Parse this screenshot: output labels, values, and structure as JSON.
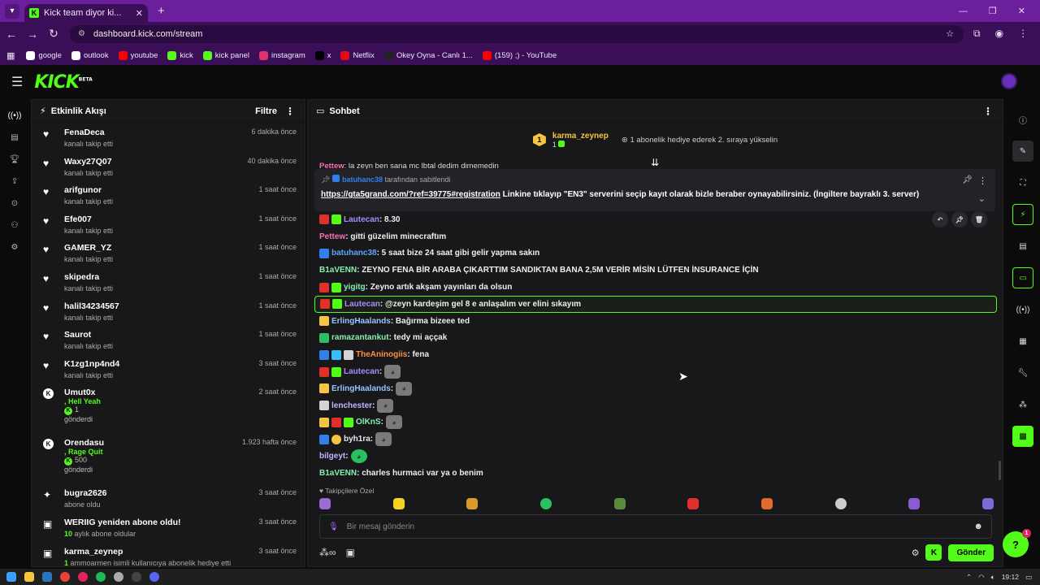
{
  "browser": {
    "tab_title": "Kick team diyor ki...",
    "tab_favicon": "K",
    "url": "dashboard.kick.com/stream",
    "bookmarks": [
      {
        "label": "google",
        "icon": "google-icon",
        "color": "#ffffff"
      },
      {
        "label": "outlook",
        "icon": "outlook-icon",
        "color": "#ffffff"
      },
      {
        "label": "youtube",
        "icon": "youtube-icon",
        "color": "#ff0000"
      },
      {
        "label": "kick",
        "icon": "kick-icon",
        "color": "#53fc18"
      },
      {
        "label": "kick panel",
        "icon": "kick-icon",
        "color": "#53fc18"
      },
      {
        "label": "instagram",
        "icon": "instagram-icon",
        "color": "#e1306c"
      },
      {
        "label": "x",
        "icon": "x-icon",
        "color": "#000000"
      },
      {
        "label": "Netflix",
        "icon": "netflix-icon",
        "color": "#e50914"
      },
      {
        "label": "Okey Oyna - Canlı 1...",
        "icon": "okey-icon",
        "color": "#222222"
      },
      {
        "label": "(159) ;) - YouTube",
        "icon": "youtube-icon",
        "color": "#ff0000"
      }
    ]
  },
  "header": {
    "logo": "KICK",
    "logo_sup": "BETA"
  },
  "activity": {
    "title": "Etkinlik Akışı",
    "filter_label": "Filtre",
    "items": [
      {
        "name": "FenaDeca",
        "sub": "kanalı takip etti",
        "time": "6 dakika önce"
      },
      {
        "name": "Waxy27Q07",
        "sub": "kanalı takip etti",
        "time": "40 dakika önce"
      },
      {
        "name": "arifgunor",
        "sub": "kanalı takip etti",
        "time": "1 saat önce"
      },
      {
        "name": "Efe007",
        "sub": "kanalı takip etti",
        "time": "1 saat önce"
      },
      {
        "name": "GAMER_YZ",
        "sub": "kanalı takip etti",
        "time": "1 saat önce"
      },
      {
        "name": "skipedra",
        "sub": "kanalı takip etti",
        "time": "1 saat önce"
      },
      {
        "name": "halil34234567",
        "sub": "kanalı takip etti",
        "time": "1 saat önce"
      },
      {
        "name": "Saurot",
        "sub": "kanalı takip etti",
        "time": "1 saat önce"
      },
      {
        "name": "K1zg1np4nd4",
        "sub": "kanalı takip etti",
        "time": "3 saat önce"
      }
    ],
    "gifts": [
      {
        "name": "Umut0x",
        "msg": ", Hell Yeah",
        "amount": "1",
        "sub": "gönderdi",
        "time": "2 saat önce"
      },
      {
        "name": "Orendasu",
        "msg": ", Rage Quit",
        "amount": "500",
        "sub": "gönderdi",
        "time": "1.923 hafta önce"
      }
    ],
    "subs": [
      {
        "name": "bugra2626",
        "sub": "abone oldu",
        "time": "3 saat önce"
      },
      {
        "name": "WERIIG yeniden abone oldu!",
        "sub_num": "10",
        "sub": "aylık abone oldular",
        "time": "3 saat önce"
      },
      {
        "name": "karma_zeynep",
        "sub_num": "1",
        "sub": "ammoarmen isimli kullanıcıya abonelik hediye etti",
        "time": "3 saat önce"
      }
    ]
  },
  "chat": {
    "title": "Sohbet",
    "banner": {
      "crest": "1",
      "user": "karma_zeynep",
      "count": "1",
      "message": "1 abonelik hediye ederek 2. sıraya yükselin"
    },
    "peek": {
      "user": "Pettew",
      "text": ": la zeyn ben sana mc lbtal dedim dimemedin"
    },
    "pinned": {
      "by_user": "batuhanc38",
      "by_suffix": " tarafından sabitlendi",
      "link": "https://gta5grand.com/?ref=39775#registration",
      "text": " Linkine tıklayıp \"EN3\" serverini seçip kayıt olarak bizle beraber oynayabilirsiniz. (İngiltere bayraklı 3. server)"
    },
    "messages": [
      {
        "user": "Lautecan",
        "color": "#a78bfa",
        "text": ": 8.30",
        "badges": [
          "red",
          "green"
        ]
      },
      {
        "user": "Pettew",
        "color": "#f472b6",
        "text": ": gitti güzelim minecraftım",
        "badges": []
      },
      {
        "user": "batuhanc38",
        "color": "#60a5fa",
        "text": ": 5 saat bize 24 saat gibi gelir yapma sakın",
        "badges": [
          "blue"
        ]
      },
      {
        "user": "B1aVENN",
        "color": "#86efac",
        "text": ": ZEYNO FENA BİR ARABA ÇIKARTTIM SANDIKTAN BANA 2,5M VERİR MİSİN LÜTFEN İNSURANCE İÇİN",
        "badges": []
      },
      {
        "user": "yigitg",
        "color": "#86efac",
        "text": ": Zeyno artık akşam yayınları da olsun",
        "badges": [
          "red",
          "green"
        ]
      },
      {
        "user": "Lautecan",
        "color": "#a78bfa",
        "text": ": @zeyn kardeşim gel 8 e anlaşalım ver elini sıkayım",
        "badges": [
          "red",
          "green"
        ],
        "highlight": true
      },
      {
        "user": "ErlingHaalands",
        "color": "#93c5fd",
        "text": ": Bağırma bizeee ted",
        "badges": [
          "gold"
        ]
      },
      {
        "user": "ramazantankut",
        "color": "#86efac",
        "text": ": tedy mi aççak",
        "badges": [
          "green2"
        ]
      },
      {
        "user": "TheAninogiis",
        "color": "#fb923c",
        "text": ": fena",
        "badges": [
          "blue",
          "teal",
          "white"
        ]
      },
      {
        "user": "Lautecan",
        "color": "#a78bfa",
        "text": ":",
        "badges": [
          "red",
          "green"
        ],
        "emote": true
      },
      {
        "user": "ErlingHaalands",
        "color": "#93c5fd",
        "text": ":",
        "badges": [
          "gold"
        ],
        "emote": true
      },
      {
        "user": "lenchester",
        "color": "#c4b5fd",
        "text": ":",
        "badges": [
          "white"
        ],
        "emote": true
      },
      {
        "user": "OlKnS",
        "color": "#86efac",
        "text": ":",
        "badges": [
          "gold",
          "red",
          "green"
        ],
        "emote": true
      },
      {
        "user": "byh1ra",
        "color": "#e5e7eb",
        "text": ":",
        "badges": [
          "blue",
          "goldc"
        ],
        "emote": true
      },
      {
        "user": "bilgeyt",
        "color": "#c4b5fd",
        "text": ":",
        "badges": [],
        "emote": true
      },
      {
        "user": "B1aVENN",
        "color": "#86efac",
        "text": ": charles hurmaci var ya o benim",
        "badges": []
      }
    ],
    "followers_label": "Takipçilere Özel",
    "input_placeholder": "Bir mesaj gönderin",
    "send_label": "Gönder"
  },
  "help_badge": "1",
  "taskbar": {
    "time": "19:12"
  },
  "colors": {
    "kick_green": "#53fc18",
    "browser_purple": "#6b1f9c"
  }
}
